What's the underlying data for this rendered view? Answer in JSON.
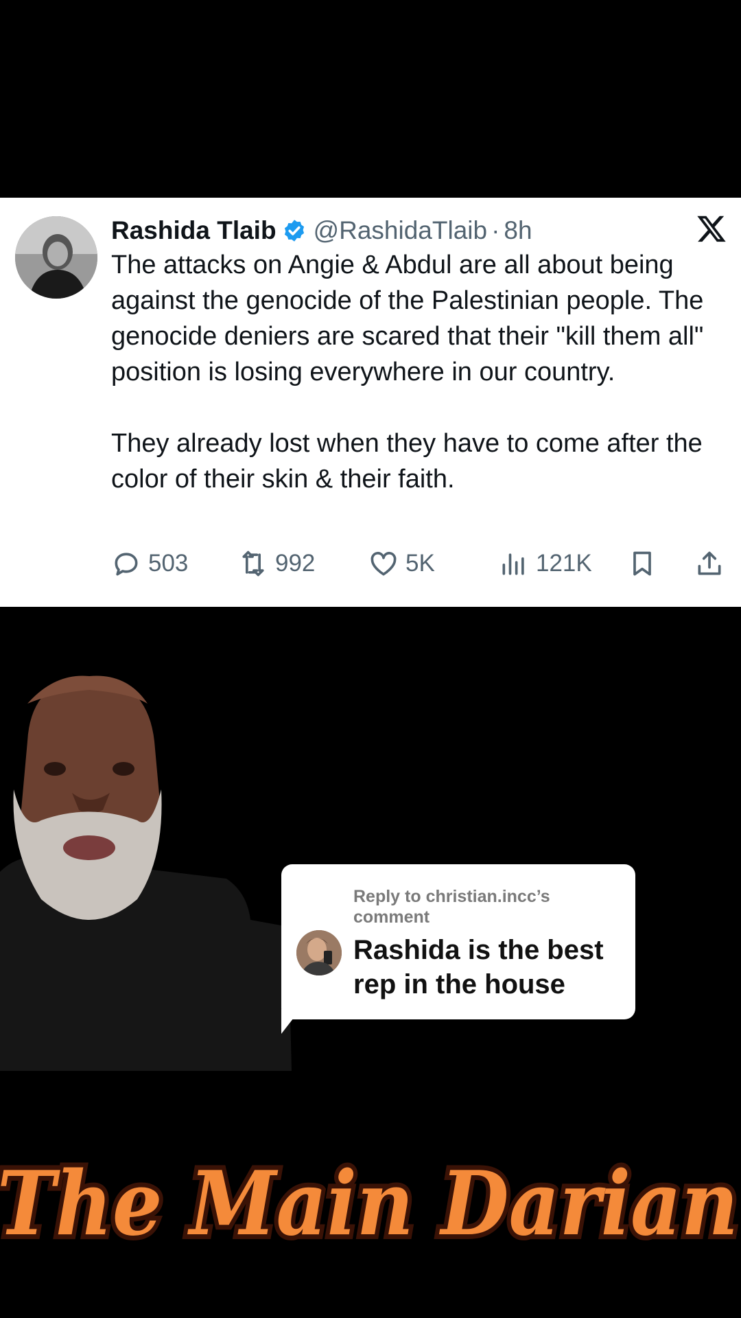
{
  "tweet": {
    "author_name": "Rashida Tlaib",
    "handle": "@RashidaTlaib",
    "separator": "·",
    "time": "8h",
    "paragraph_1": "The attacks on Angie & Abdul are all about being against the genocide of the Palestinian people. The genocide deniers are scared that their \"kill them all\" position is losing everywhere in our country.",
    "paragraph_2": "They already lost when they have to come after the color of their skin & their faith.",
    "replies": "503",
    "reposts": "992",
    "likes": "5K",
    "views": "121K"
  },
  "reply_card": {
    "reply_to": "Reply to christian.incc’s comment",
    "comment": "Rashida is the best rep in the house"
  },
  "channel_title": "The Main Darian",
  "colors": {
    "background": "#000000",
    "card": "#ffffff",
    "verified_blue": "#1d9bf0",
    "muted_text": "#536471",
    "title_orange": "#f48a3a",
    "title_outline": "#3a1206"
  },
  "icons": {
    "verified": "verified-badge-icon",
    "x_logo": "x-logo-icon",
    "reply": "reply-bubble-icon",
    "repost": "repost-icon",
    "like": "heart-icon",
    "views": "views-bar-icon",
    "bookmark": "bookmark-icon",
    "share": "share-icon"
  }
}
